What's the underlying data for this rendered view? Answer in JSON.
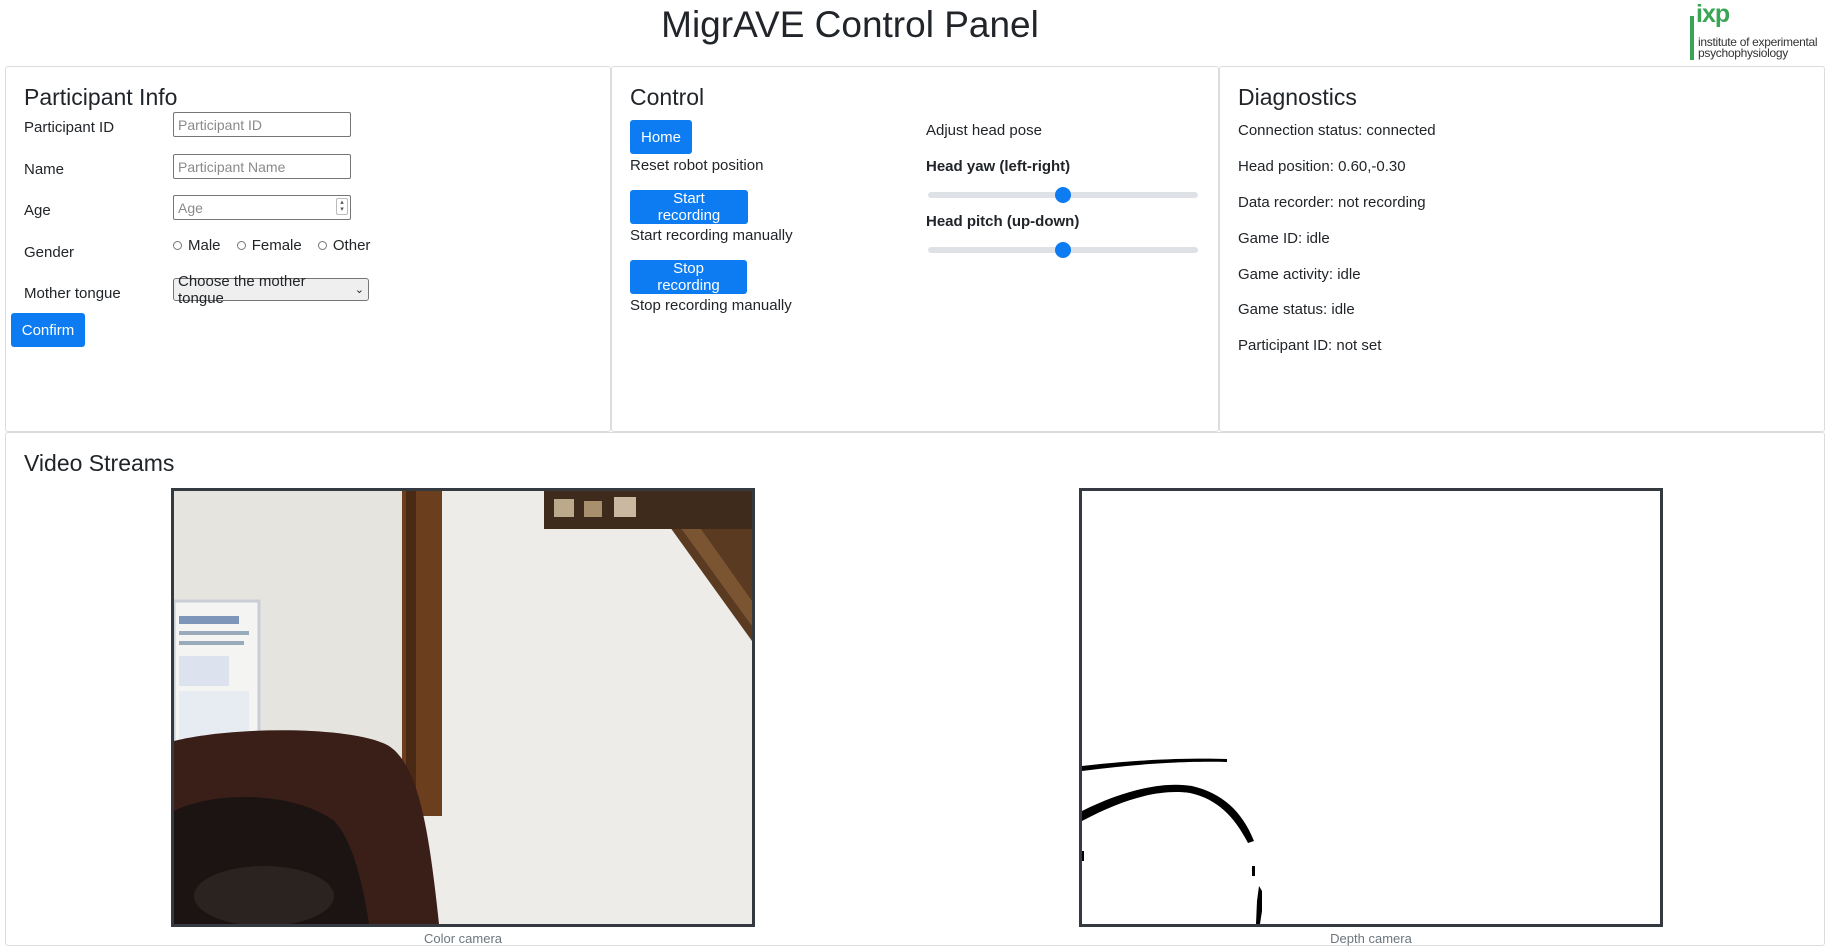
{
  "app_title": "MigrAVE Control Panel",
  "logo": {
    "mark": "ixp",
    "line1": "institute of experimental",
    "line2": "psychophysiology"
  },
  "participant_info": {
    "title": "Participant Info",
    "participant_id_label": "Participant ID",
    "participant_id_placeholder": "Participant ID",
    "name_label": "Name",
    "name_placeholder": "Participant Name",
    "age_label": "Age",
    "age_placeholder": "Age",
    "gender_label": "Gender",
    "gender_options": [
      "Male",
      "Female",
      "Other"
    ],
    "mother_tongue_label": "Mother tongue",
    "mother_tongue_selected": "Choose the mother tongue",
    "confirm_label": "Confirm"
  },
  "control": {
    "title": "Control",
    "home_label": "Home",
    "home_caption": "Reset robot position",
    "start_label": "Start recording",
    "start_caption": "Start recording manually",
    "stop_label": "Stop recording",
    "stop_caption": "Stop recording manually",
    "head_pose_title": "Adjust head pose",
    "yaw_label": "Head yaw (left-right)",
    "yaw_value_fraction": 0.5,
    "pitch_label": "Head pitch (up-down)",
    "pitch_value_fraction": 0.5
  },
  "diagnostics": {
    "title": "Diagnostics",
    "lines": [
      "Connection status: connected",
      "Head position: 0.60,-0.30",
      "Data recorder: not recording",
      "Game ID: idle",
      "Game activity: idle",
      "Game status: idle",
      "Participant ID: not set"
    ]
  },
  "video_streams": {
    "title": "Video Streams",
    "color_caption": "Color camera",
    "depth_caption": "Depth camera"
  },
  "colors": {
    "primary": "#0d7cf2",
    "logo_green": "#3aa655",
    "frame_border": "#343a40"
  }
}
